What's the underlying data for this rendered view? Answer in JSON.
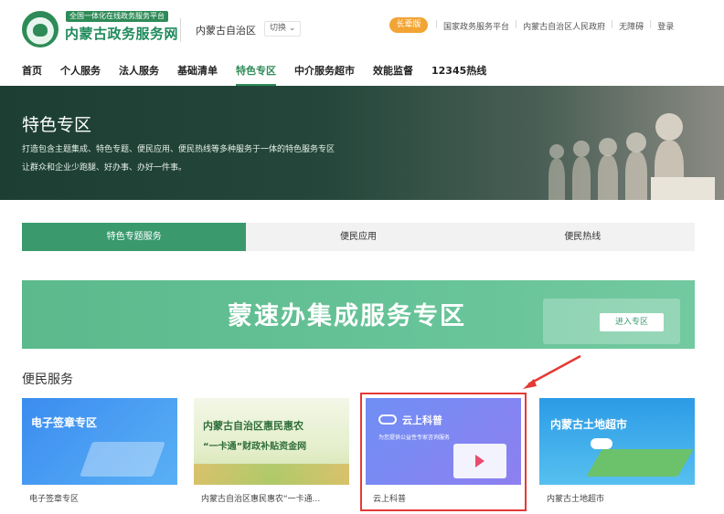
{
  "header": {
    "logo_badge": "全国一体化在线政务服务平台",
    "logo_title": "内蒙古政务服务网",
    "region": "内蒙古自治区",
    "switch_label": "切换",
    "elder_label": "长辈版",
    "links": [
      "国家政务服务平台",
      "内蒙古自治区人民政府",
      "无障碍",
      "登录"
    ]
  },
  "nav": {
    "items": [
      "首页",
      "个人服务",
      "法人服务",
      "基础清单",
      "特色专区",
      "中介服务超市",
      "效能监督",
      "12345热线"
    ],
    "active_index": 4
  },
  "hero": {
    "title": "特色专区",
    "line1": "打造包含主题集成、特色专题、便民应用、便民热线等多种服务于一体的特色服务专区",
    "line2": "让群众和企业少跑腿、好办事、办好一件事。"
  },
  "tabs": [
    "特色专题服务",
    "便民应用",
    "便民热线"
  ],
  "banner": {
    "title": "蒙速办集成服务专区",
    "button": "进入专区"
  },
  "section": {
    "title": "便民服务",
    "cards": [
      {
        "image_title": "电子签章专区",
        "label": "电子签章专区"
      },
      {
        "image_title": "内蒙古自治区惠民惠农",
        "image_subtitle": "“一卡通”财政补贴资金网",
        "label": "内蒙古自治区惠民惠农“一卡通..."
      },
      {
        "image_title": "云上科普",
        "image_subtitle": "为您提供公益性专家咨询服务",
        "label": "云上科普"
      },
      {
        "image_title": "内蒙古土地超市",
        "label": "内蒙古土地超市"
      }
    ]
  },
  "colors": {
    "brand": "#2e8b57",
    "tab_active": "#3a9a6e",
    "highlight": "#e53935",
    "elder": "#f2a434"
  }
}
